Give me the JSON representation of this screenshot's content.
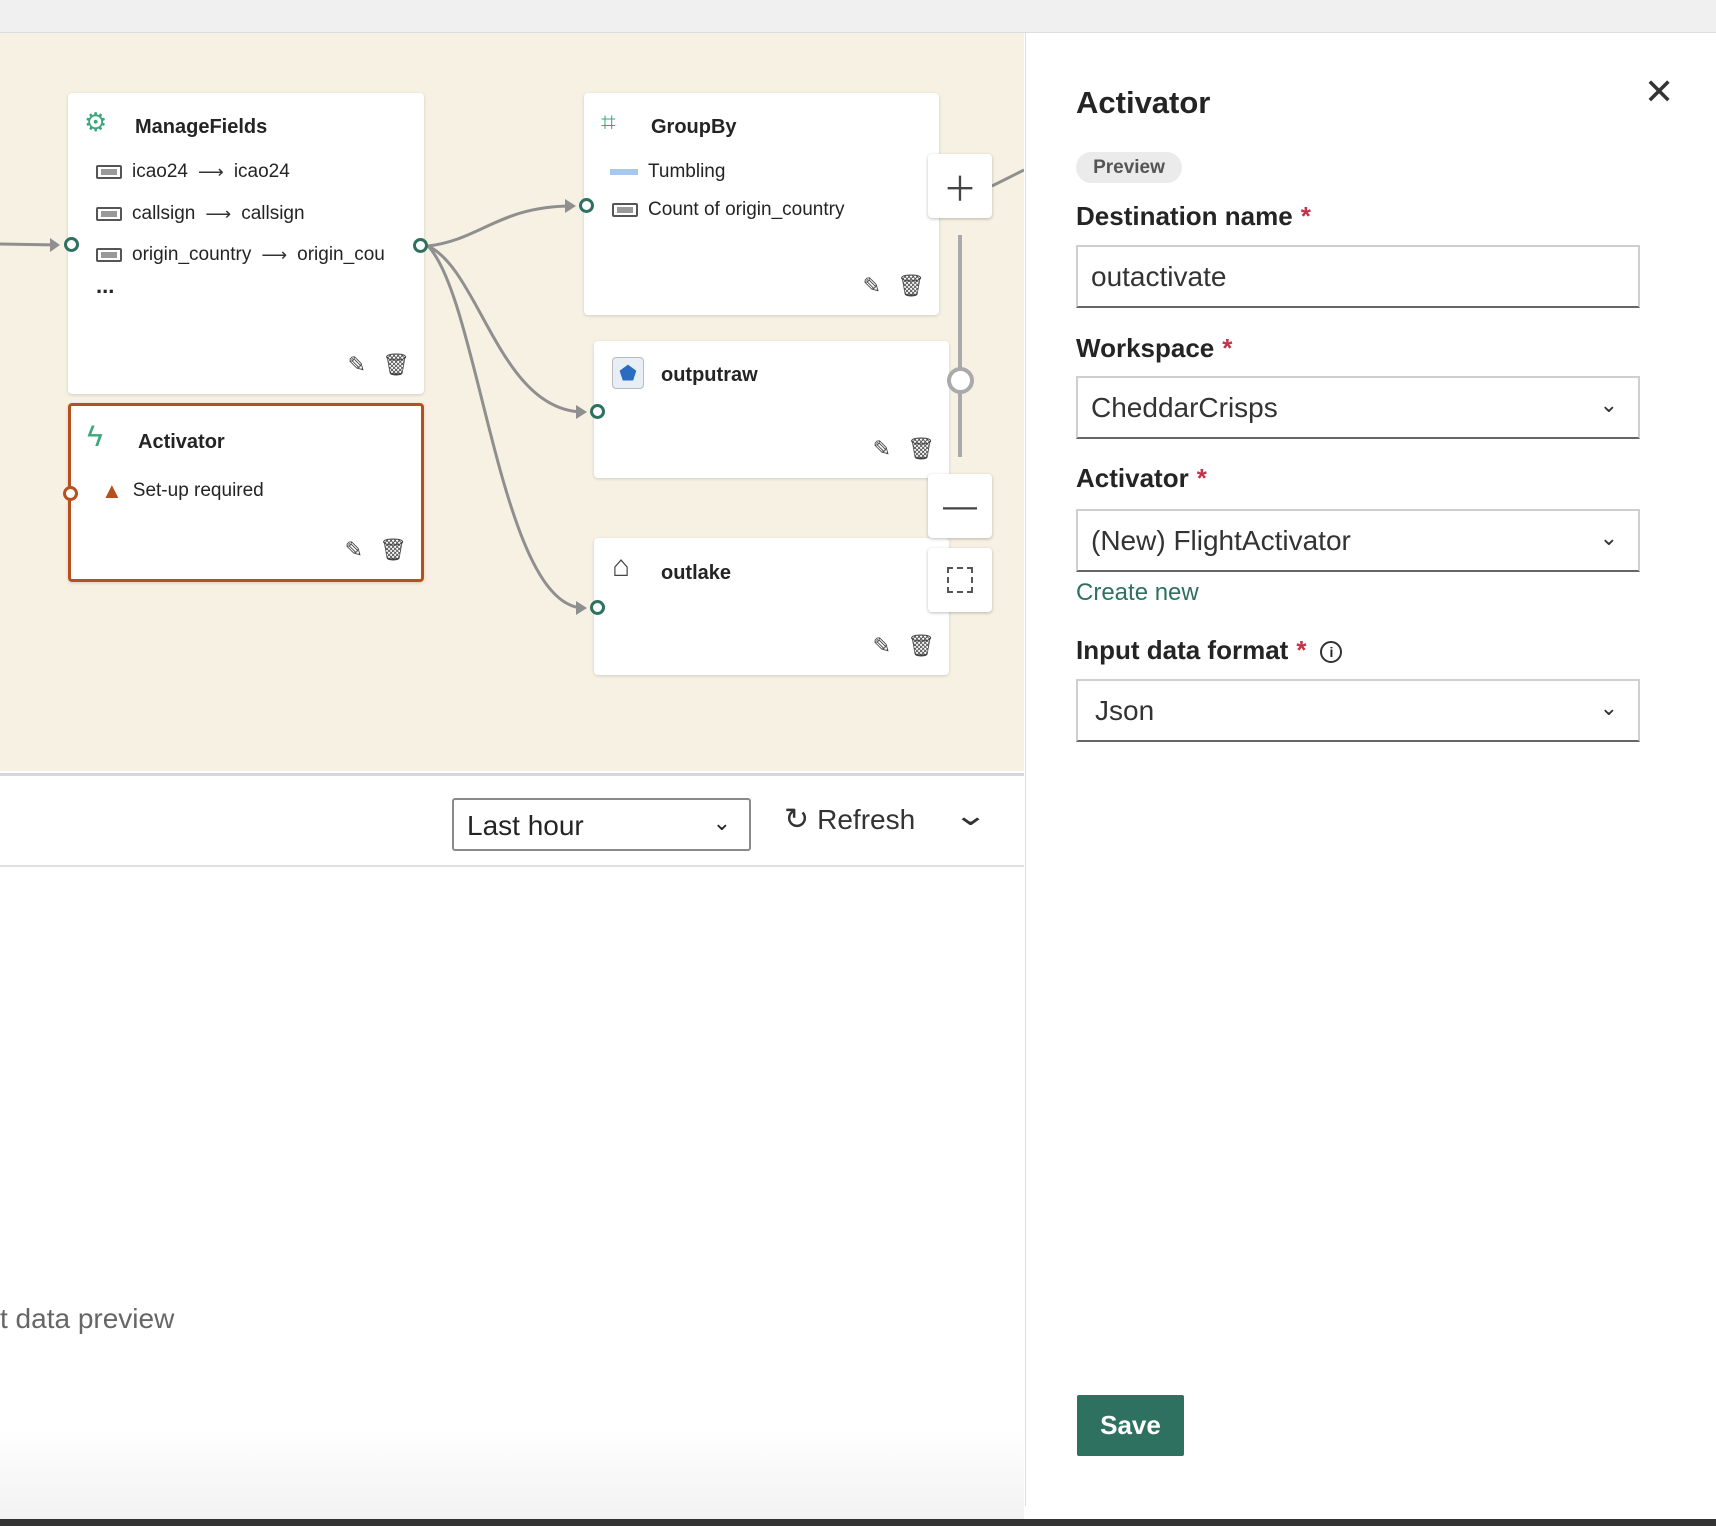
{
  "canvas": {
    "nodes": {
      "managefields": {
        "title": "ManageFields",
        "rows": [
          {
            "from": "icao24",
            "to": "icao24"
          },
          {
            "from": "callsign",
            "to": "callsign"
          },
          {
            "from": "origin_country",
            "to": "origin_cou"
          }
        ],
        "more": "..."
      },
      "activator": {
        "title": "Activator",
        "status": "Set-up required"
      },
      "groupby": {
        "title": "GroupBy",
        "window": "Tumbling",
        "aggregate": "Count of origin_country"
      },
      "outputraw": {
        "title": "outputraw"
      },
      "outlake": {
        "title": "outlake"
      }
    },
    "zoom_level": 0.45,
    "colors": {
      "canvas": "#f7f1e4",
      "port": "#2e7160",
      "error": "#b7501f"
    }
  },
  "bottom": {
    "time_range": "Last hour",
    "refresh_label": "Refresh",
    "empty_text": "t data preview"
  },
  "panel": {
    "title": "Activator",
    "badge": "Preview",
    "destination_label": "Destination name",
    "destination_value": "outactivate",
    "workspace_label": "Workspace",
    "workspace_value": "CheddarCrisps",
    "activator_label": "Activator",
    "activator_value": "(New) FlightActivator",
    "create_new": "Create new",
    "format_label": "Input data format",
    "format_value": "Json",
    "required_mark": "*",
    "save_label": "Save",
    "colors": {
      "save": "#2e7160",
      "link": "#2e7160",
      "required": "#c4314b"
    }
  }
}
